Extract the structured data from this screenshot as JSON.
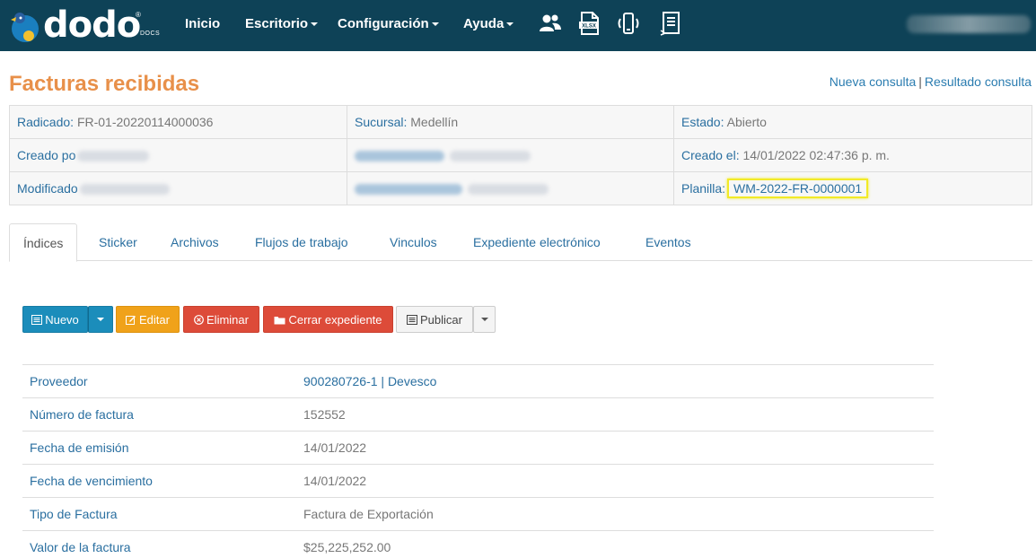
{
  "app": {
    "logo_text": "dodo",
    "logo_sub": "DOCS"
  },
  "nav": {
    "items": [
      {
        "label": "Inicio"
      },
      {
        "label": "Escritorio"
      },
      {
        "label": "Configuración"
      },
      {
        "label": "Ayuda"
      }
    ],
    "icons": [
      "users-icon",
      "xlsx-icon",
      "mobile-icon",
      "document-list-icon"
    ]
  },
  "page": {
    "title": "Facturas recibidas",
    "link_new": "Nueva consulta",
    "link_sep": "|",
    "link_result": "Resultado consulta"
  },
  "info": {
    "radicado_label": "Radicado:",
    "radicado_value": "FR-01-20220114000036",
    "sucursal_label": "Sucursal:",
    "sucursal_value": "Medellín",
    "estado_label": "Estado:",
    "estado_value": "Abierto",
    "creado_por_label": "Creado po",
    "creado_el_label": "Creado el:",
    "creado_el_value": "14/01/2022 02:47:36 p. m.",
    "modificado_label": "Modificado",
    "planilla_label": "Planilla:",
    "planilla_value": "WM-2022-FR-0000001"
  },
  "tabs": [
    {
      "label": "Índices",
      "active": true
    },
    {
      "label": "Sticker"
    },
    {
      "label": "Archivos"
    },
    {
      "label": "Flujos de trabajo"
    },
    {
      "label": "Vinculos"
    },
    {
      "label": "Expediente electrónico"
    },
    {
      "label": "Eventos"
    }
  ],
  "buttons": {
    "nuevo": "Nuevo",
    "editar": "Editar",
    "eliminar": "Eliminar",
    "cerrar": "Cerrar expediente",
    "publicar": "Publicar"
  },
  "detail": [
    {
      "key": "Proveedor",
      "value": "900280726-1 | Devesco"
    },
    {
      "key": "Número de factura",
      "value": "152552"
    },
    {
      "key": "Fecha de emisión",
      "value": "14/01/2022"
    },
    {
      "key": "Fecha de vencimiento",
      "value": "14/01/2022"
    },
    {
      "key": "Tipo de Factura",
      "value": "Factura de Exportación"
    },
    {
      "key": "Valor de la factura",
      "value": "$25,225,252.00"
    }
  ],
  "colors": {
    "navbar": "#0e4257",
    "title": "#e8904a",
    "link": "#2a6fa0",
    "highlight": "#f2ea26"
  }
}
